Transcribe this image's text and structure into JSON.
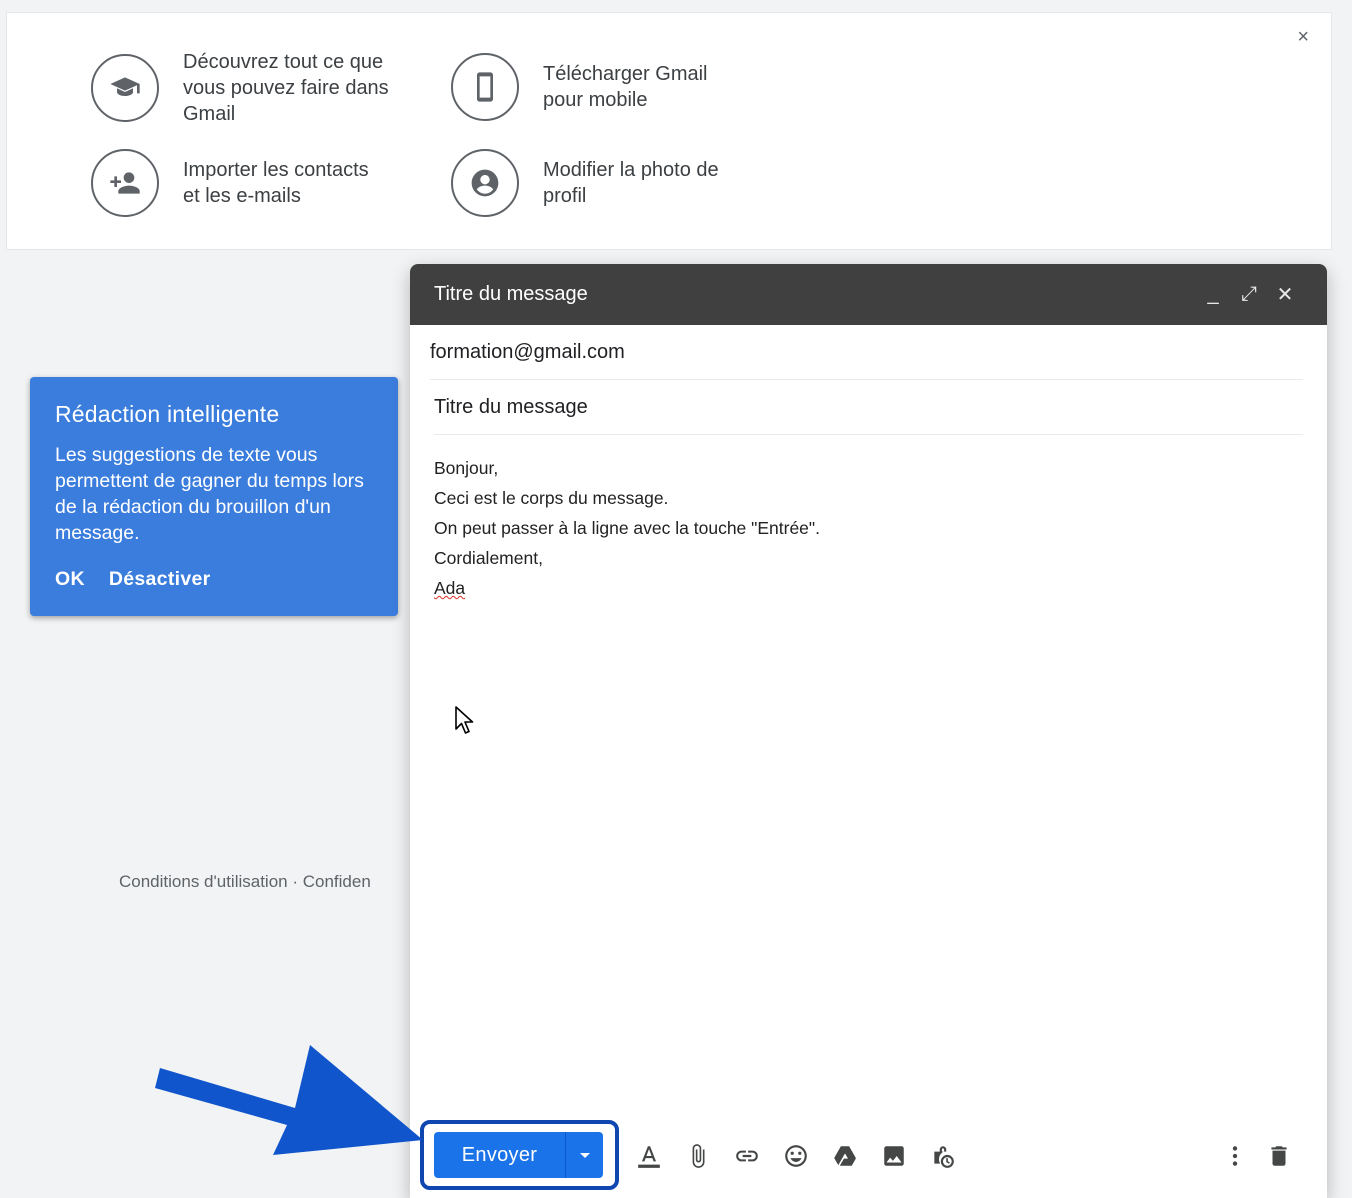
{
  "welcome": {
    "close_label": "×",
    "tips": [
      {
        "icon": "graduation-cap-icon",
        "text": "Découvrez tout ce que\nvous pouvez faire dans\nGmail"
      },
      {
        "icon": "smartphone-icon",
        "text": "Télécharger Gmail\npour mobile"
      },
      {
        "icon": "add-person-icon",
        "text": "Importer les contacts\net les e-mails"
      },
      {
        "icon": "account-circle-icon",
        "text": "Modifier la photo de\nprofil"
      }
    ]
  },
  "footer": {
    "text": "Conditions d'utilisation · Confiden"
  },
  "smart_compose": {
    "title": "Rédaction intelligente",
    "description": "Les suggestions de texte vous permettent de gagner du temps lors de la rédaction du brouillon d'un message.",
    "ok_label": "OK",
    "disable_label": "Désactiver"
  },
  "compose": {
    "header_title": "Titre du message",
    "minimize_label": "_",
    "expand_label": "⤢",
    "close_label": "✕",
    "to": "formation@gmail.com",
    "subject": "Titre du message",
    "body_lines": [
      "Bonjour,",
      "Ceci est le corps du message.",
      "On peut passer à la ligne avec la touche \"Entrée\".",
      "Cordialement,",
      "Ada"
    ],
    "send_label": "Envoyer"
  },
  "colors": {
    "accent": "#1a73e8",
    "popup": "#3b7ddd",
    "header": "#404040",
    "arrow": "#1155cc"
  }
}
